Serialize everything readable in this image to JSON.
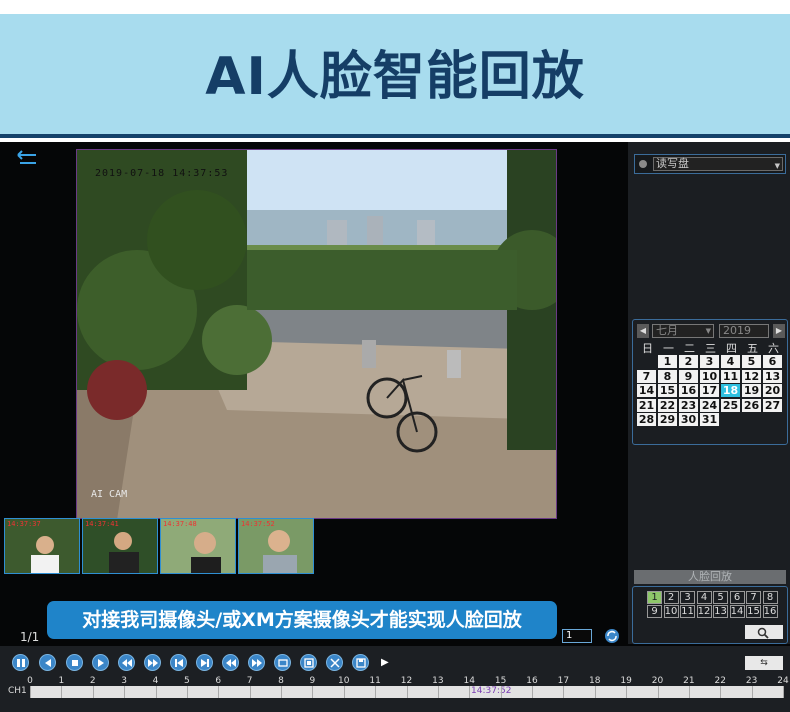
{
  "banner": {
    "title": "AI人脸智能回放"
  },
  "video": {
    "osd_time": "2019-07-18 14:37:53",
    "osd_cam": "AI CAM"
  },
  "thumbnails": [
    {
      "time": "14:37:37"
    },
    {
      "time": "14:37:41"
    },
    {
      "time": "14:37:48"
    },
    {
      "time": "14:37:52"
    }
  ],
  "caption": "对接我司摄像头/或XM方案摄像头才能实现人脸回放",
  "page_count": "1/1",
  "channel_value": "1",
  "disk": {
    "selected": "读写盘"
  },
  "calendar": {
    "month": "七月",
    "year": "2019",
    "weekdays": [
      "日",
      "一",
      "二",
      "三",
      "四",
      "五",
      "六"
    ],
    "rows": [
      [
        "",
        "1",
        "2",
        "3",
        "4",
        "5",
        "6"
      ],
      [
        "7",
        "8",
        "9",
        "10",
        "11",
        "12",
        "13"
      ],
      [
        "14",
        "15",
        "16",
        "17",
        "18",
        "19",
        "20"
      ],
      [
        "21",
        "22",
        "23",
        "24",
        "25",
        "26",
        "27"
      ],
      [
        "28",
        "29",
        "30",
        "31",
        "",
        "",
        ""
      ]
    ],
    "selected_day": "18"
  },
  "face_playback": {
    "title": "人脸回放",
    "numbers_row1": [
      "1",
      "2",
      "3",
      "4",
      "5",
      "6",
      "7",
      "8"
    ],
    "numbers_row2": [
      "9",
      "10",
      "11",
      "12",
      "13",
      "14",
      "15",
      "16"
    ],
    "active": "1"
  },
  "timeline": {
    "channel": "CH1",
    "hours": [
      "0",
      "1",
      "2",
      "3",
      "4",
      "5",
      "6",
      "7",
      "8",
      "9",
      "10",
      "11",
      "12",
      "13",
      "14",
      "15",
      "16",
      "17",
      "18",
      "19",
      "20",
      "21",
      "22",
      "23",
      "24"
    ],
    "cursor_time": "14:37:52"
  },
  "colors": {
    "accent": "#3b86c8",
    "banner_bg": "#a8dcee",
    "caption_bg": "#1f84c9",
    "selected_day": "#2fc0e0"
  }
}
